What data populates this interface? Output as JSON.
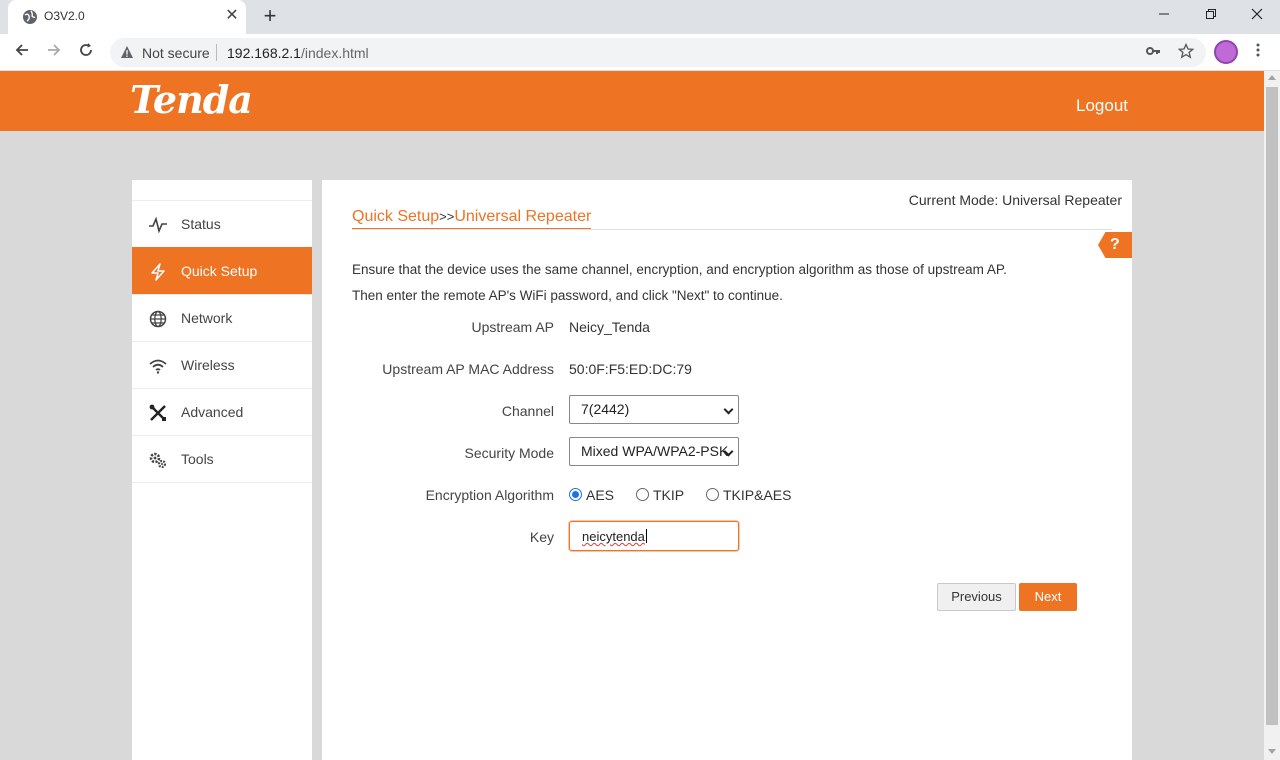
{
  "browser": {
    "tab_title": "O3V2.0",
    "tab_close": "✕",
    "new_tab": "+",
    "security_label": "Not secure",
    "url_host": "192.168.2.1",
    "url_path": "/index.html"
  },
  "router": {
    "brand": "Tenda",
    "logout": "Logout",
    "accent_color": "#ee7323"
  },
  "sidebar": {
    "items": [
      {
        "label": "Status",
        "icon": "pulse-icon",
        "active": false
      },
      {
        "label": "Quick Setup",
        "icon": "lightning-icon",
        "active": true
      },
      {
        "label": "Network",
        "icon": "globe-icon",
        "active": false
      },
      {
        "label": "Wireless",
        "icon": "wifi-icon",
        "active": false
      },
      {
        "label": "Advanced",
        "icon": "tools-icon",
        "active": false
      },
      {
        "label": "Tools",
        "icon": "gears-icon",
        "active": false
      }
    ]
  },
  "main": {
    "current_mode": "Current Mode: Universal Repeater",
    "breadcrumb": {
      "first": "Quick Setup",
      "separator": ">>",
      "second": "Universal Repeater"
    },
    "help": "?",
    "desc_line1": "Ensure that the device uses the same channel, encryption, and encryption algorithm as those of upstream AP.",
    "desc_line2": "Then enter the remote AP's WiFi password, and click \"Next\" to continue.",
    "form": {
      "upstream_ap_label": "Upstream AP",
      "upstream_ap_value": "Neicy_Tenda",
      "mac_label": "Upstream AP MAC Address",
      "mac_value": "50:0F:F5:ED:DC:79",
      "channel_label": "Channel",
      "channel_value": "7(2442)",
      "security_label": "Security Mode",
      "security_value": "Mixed WPA/WPA2-PSK",
      "encryption_label": "Encryption Algorithm",
      "encryption_options": [
        "AES",
        "TKIP",
        "TKIP&AES"
      ],
      "encryption_selected": "AES",
      "key_label": "Key",
      "key_value": "neicytenda"
    },
    "buttons": {
      "previous": "Previous",
      "next": "Next"
    }
  }
}
